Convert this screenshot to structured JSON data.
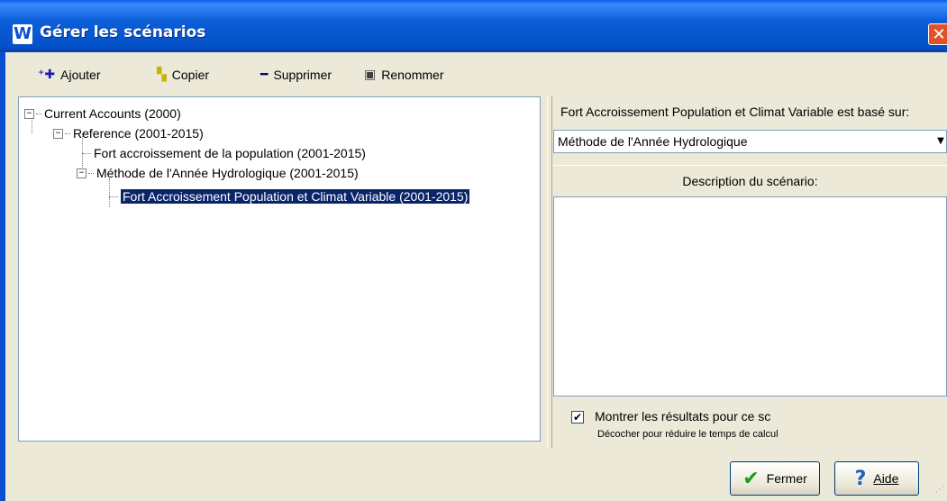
{
  "window": {
    "app_icon": "W",
    "title": "Gérer les scénarios",
    "close_icon": "✕"
  },
  "toolbar": {
    "add_label": "Ajouter",
    "add_icon": "add-icon",
    "copy_label": "Copier",
    "copy_icon": "copy-icon",
    "delete_label": "Supprimer",
    "delete_icon": "minus-icon",
    "rename_label": "Renommer",
    "rename_icon": "rename-icon"
  },
  "tree": {
    "items": [
      {
        "label": "Current Accounts (2000)",
        "expander": "−"
      },
      {
        "label": "Reference (2001-2015)",
        "expander": "−"
      },
      {
        "label": "Fort accroissement de la population (2001-2015)"
      },
      {
        "label": "Méthode de l'Année Hydrologique (2001-2015)",
        "expander": "−"
      },
      {
        "label": "Fort Accroissement Population et Climat Variable (2001-2015)",
        "selected": true
      }
    ]
  },
  "right_panel": {
    "based_on_label": "Fort Accroissement Population et Climat Variable est basé sur:",
    "based_on_value": "Méthode de l'Année Hydrologique",
    "dropdown_arrow": "▼",
    "description_header": "Description du scénario:",
    "description_text": "",
    "show_results_label": "Montrer les résultats pour ce sc",
    "show_results_checked": "✔",
    "show_results_hint": "Décocher pour réduire le temps de calcul"
  },
  "buttons": {
    "close_label": "Fermer",
    "close_icon": "✔",
    "help_label": "Aide",
    "help_icon": "?"
  },
  "colors": {
    "titlebar": "#0b5ed7",
    "selection": "#0a246a",
    "background": "#ece9d8",
    "check_green": "#1a9a1a",
    "help_blue": "#1f5fbf"
  }
}
